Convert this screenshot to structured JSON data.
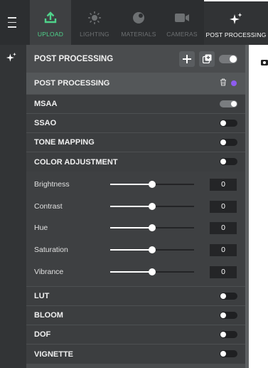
{
  "topbar": {
    "tabs": [
      {
        "label": "UPLOAD",
        "icon": "upload-icon"
      },
      {
        "label": "LIGHTING",
        "icon": "sun-icon"
      },
      {
        "label": "MATERIALS",
        "icon": "materials-icon"
      },
      {
        "label": "CAMERAS",
        "icon": "camera-icon"
      },
      {
        "label": "POST PROCESSING",
        "icon": "sparkle-icon"
      }
    ],
    "active_tab": "POST PROCESSING"
  },
  "panel": {
    "title": "POST PROCESSING",
    "section_title": "POST PROCESSING",
    "section_color": "#8e5cf0",
    "items": {
      "msaa": "MSAA",
      "ssao": "SSAO",
      "tone_mapping": "TONE MAPPING",
      "color_adjustment": "COLOR ADJUSTMENT",
      "lut": "LUT",
      "bloom": "BLOOM",
      "dof": "DOF",
      "vignette": "VIGNETTE"
    },
    "toggles": {
      "post_processing": true,
      "msaa": true,
      "ssao": false,
      "tone_mapping": false,
      "color_adjustment": false,
      "lut": false,
      "bloom": false,
      "dof": false,
      "vignette": false
    },
    "color_adjustment": {
      "brightness": {
        "label": "Brightness",
        "value": "0",
        "slider_fraction": 0.5
      },
      "contrast": {
        "label": "Contrast",
        "value": "0",
        "slider_fraction": 0.5
      },
      "hue": {
        "label": "Hue",
        "value": "0",
        "slider_fraction": 0.5
      },
      "saturation": {
        "label": "Saturation",
        "value": "0",
        "slider_fraction": 0.5
      },
      "vibrance": {
        "label": "Vibrance",
        "value": "0",
        "slider_fraction": 0.5
      }
    }
  },
  "colors": {
    "accent_green": "#4fd38b",
    "accent_purple": "#8e5cf0"
  }
}
